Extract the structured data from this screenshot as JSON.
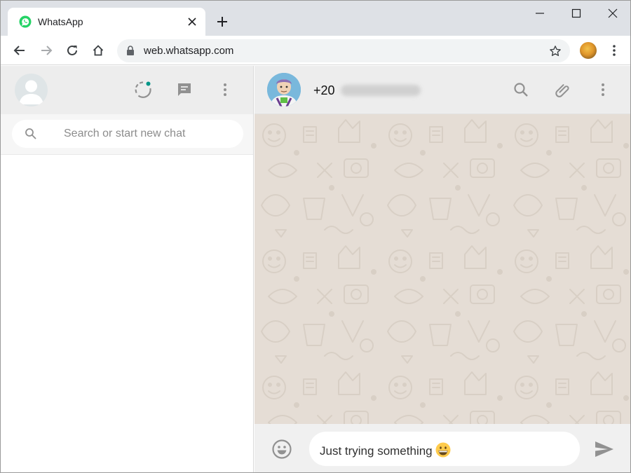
{
  "browser": {
    "tab": {
      "title": "WhatsApp",
      "favicon": "whatsapp-icon"
    },
    "new_tab_icon": "plus-icon",
    "window_controls": [
      "minimize-icon",
      "maximize-icon",
      "close-icon"
    ],
    "nav": [
      "back-icon",
      "forward-icon",
      "reload-icon",
      "home-icon"
    ],
    "address": {
      "url": "web.whatsapp.com",
      "security_icon": "lock-icon",
      "bookmark_icon": "star-icon"
    },
    "menu_icon": "kebab-menu-icon"
  },
  "sidebar": {
    "header_icons": [
      "status-icon",
      "new-chat-icon",
      "menu-icon"
    ],
    "status_dot_color": "#009688",
    "search": {
      "placeholder": "Search or start new chat",
      "value": ""
    }
  },
  "chat": {
    "contact": {
      "name_prefix": "+20"
    },
    "header_icons": [
      "search-icon",
      "attach-icon",
      "menu-icon"
    ],
    "compose": {
      "text": "Just trying something",
      "emoji": "grinning-face"
    },
    "footer_icons": [
      "emoji-icon",
      "send-icon"
    ]
  },
  "colors": {
    "tabstrip": "#dee1e6",
    "header": "#ededed",
    "chat_background": "#e5ddd5",
    "doodle": "#d8cfc5",
    "whatsapp_green": "#25d366",
    "icon_gray": "#919191"
  }
}
